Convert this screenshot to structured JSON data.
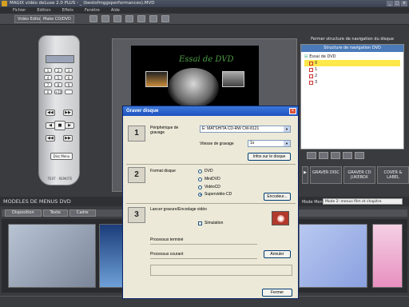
{
  "window": {
    "title": "MAGIX vidéo deLuxe 2.0 PLUS - _ (bestofmggsperformances).MVD",
    "controls": [
      "_",
      "□",
      "×"
    ]
  },
  "menu": [
    "Fichier",
    "Edition",
    "Effets",
    "Fenêtre",
    "Aide"
  ],
  "toolbar": {
    "tab_video_editor": "Vidéo Editor",
    "tab_make_cd": "Make CD/DVD"
  },
  "remote": {
    "keys": [
      "1",
      "2",
      "3",
      "4",
      "5",
      "6",
      "7",
      "8",
      "9",
      "0",
      "+10",
      ""
    ],
    "disc_menu": "Disc Menu",
    "brand": "TEXT · REMOTE"
  },
  "preview": {
    "title": "Essai de DVD"
  },
  "structure": {
    "header": "Fermer structure de navigation du disque",
    "panel_title": "Structure de navigation DVD",
    "root": "Essai de DVD",
    "items": [
      "0",
      "1",
      "2",
      "3"
    ]
  },
  "right_buttons": {
    "burn": "GRAVER DISC",
    "burn_jukebox": "GRAVER CD JUKEBOX",
    "cover": "COVER & LABEL"
  },
  "models": {
    "title": "MODELES DE MENUS DVD",
    "mode_label": "Mode Menu",
    "mode_value": "Mode 2: menus film et chapitre",
    "tabs": [
      "Disposition",
      "Texte",
      "Cadre"
    ]
  },
  "dialog": {
    "title": "Graver disque",
    "close": "×",
    "step1": "1",
    "step2": "2",
    "step3": "3",
    "device_label": "Périphérique de gravage",
    "device_value": "E: MATSHITA CD-RW  CW-8121",
    "speed_label": "Vitesse de gravage",
    "speed_value": "1x",
    "disc_info_btn": "Infos sur le disque",
    "format_label": "Format disque",
    "formats": [
      "DVD",
      "MiniDVD",
      "VidéoCD",
      "Supervidéo-CD"
    ],
    "selected_format": "Supervidéo-CD",
    "encoder_btn": "Encodeur...",
    "launch_label": "Lancer gravure/Encodage vidéo",
    "simulation": "Simulation",
    "process_done": "Processus terminé",
    "process_current": "Processus courant",
    "cancel_btn": "Annuler",
    "close_btn": "Fermer"
  }
}
